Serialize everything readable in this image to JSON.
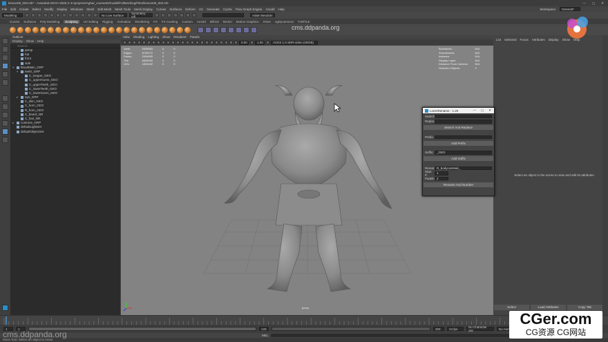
{
  "titlebar": {
    "title": "lesson09_003.mb* - Autodesk MAYA 2025.3: E:/projects/Agha/_course02/model/FullWorking/Files/lesson09_003.mb"
  },
  "menubar": {
    "items": [
      "File",
      "Edit",
      "Create",
      "Select",
      "Modify",
      "Display",
      "Windows",
      "Mesh",
      "Edit Mesh",
      "Mesh Tools",
      "Mesh Display",
      "Curves",
      "Surfaces",
      "Deform",
      "UV",
      "Generate",
      "Cache",
      "Flow Graph Engine",
      "Arnold",
      "Help"
    ],
    "workspace_label": "Workspace:",
    "workspace_value": "General*"
  },
  "statusline": {
    "mode": "Modeling",
    "live_surface": "No Live Surface",
    "symmetry": "Symmetry: Off",
    "user": "Adam Beudoin"
  },
  "shelf": {
    "tabs": [
      "Curves",
      "Surfaces",
      "Poly Modeling",
      "Sculpting",
      "UV Editing",
      "Rigging",
      "Animation",
      "Rendering",
      "FX",
      "FX Caching",
      "Custom",
      "Arnold",
      "Bifrost",
      "MASH",
      "Motion Graphics",
      "XGen",
      "xgDynamics2",
      "TURTLE"
    ],
    "active_tab": "Sculpting"
  },
  "outliner": {
    "title": "Outliner",
    "menu": [
      "Display",
      "Show",
      "Help"
    ],
    "search_placeholder": "Search...",
    "items": [
      {
        "label": "persp",
        "indent": 1,
        "arrow": ""
      },
      {
        "label": "top",
        "indent": 1,
        "arrow": ""
      },
      {
        "label": "front",
        "indent": 1,
        "arrow": ""
      },
      {
        "label": "side",
        "indent": 1,
        "arrow": ""
      },
      {
        "label": "bloodMain_GRP",
        "indent": 0,
        "arrow": "▾"
      },
      {
        "label": "teeth_GRP",
        "indent": 1,
        "arrow": "▾"
      },
      {
        "label": "C_tongue_GEO",
        "indent": 2,
        "arrow": ""
      },
      {
        "label": "C_upperGums_GEO",
        "indent": 2,
        "arrow": ""
      },
      {
        "label": "C_upperTeeth_GEO",
        "indent": 2,
        "arrow": ""
      },
      {
        "label": "C_lowerTeeth_GEO",
        "indent": 2,
        "arrow": ""
      },
      {
        "label": "C_lowerGums_GEO",
        "indent": 2,
        "arrow": ""
      },
      {
        "label": "eye_GRP",
        "indent": 1,
        "arrow": "▸"
      },
      {
        "label": "C_skin_GEO",
        "indent": 1,
        "arrow": ""
      },
      {
        "label": "C_horn_GEO",
        "indent": 1,
        "arrow": ""
      },
      {
        "label": "R_horn_GEO",
        "indent": 1,
        "arrow": ""
      },
      {
        "label": "C_beard_NR",
        "indent": 1,
        "arrow": ""
      },
      {
        "label": "C_hair_NR",
        "indent": 1,
        "arrow": ""
      },
      {
        "label": "costume_GRP",
        "indent": 0,
        "arrow": "▸"
      },
      {
        "label": "defaultLightSet",
        "indent": 0,
        "arrow": ""
      },
      {
        "label": "defaultObjectSet",
        "indent": 0,
        "arrow": ""
      }
    ]
  },
  "viewport": {
    "menu": [
      "View",
      "Shading",
      "Lighting",
      "Show",
      "Renderer",
      "Panels"
    ],
    "hud": [
      {
        "label": "Verts:",
        "a": "2935963",
        "b": "0",
        "c": "0"
      },
      {
        "label": "Edges:",
        "a": "8709272",
        "b": "0",
        "c": "0"
      },
      {
        "label": "Faces:",
        "a": "2934695",
        "b": "0",
        "c": "0"
      },
      {
        "label": "Tris:",
        "a": "4899090",
        "b": "0",
        "c": "0"
      },
      {
        "label": "UVs:",
        "a": "1834432",
        "b": "0",
        "c": "0"
      }
    ],
    "camera_label": "persp",
    "toolbar_field_a": "0.00",
    "toolbar_field_b": "1.00",
    "colorspace": "ACES 1.0 SDR-video (sRGB)"
  },
  "rightpanel": {
    "menu": [
      "List",
      "Selected",
      "Focus",
      "Attributes",
      "Display",
      "Show",
      "Help"
    ],
    "empty_message": "Select an object in the scene to view and edit its attributes",
    "info": [
      {
        "label": "Backfaces:",
        "value": "N/A"
      },
      {
        "label": "Smoothness:",
        "value": "N/A"
      },
      {
        "label": "Instance:",
        "value": "N/A"
      },
      {
        "label": "Display Layer:",
        "value": "N/A"
      },
      {
        "label": "Distance From Camera:",
        "value": "N/A"
      },
      {
        "label": "Selected Objects:",
        "value": "0"
      }
    ],
    "buttons": [
      "Select",
      "Load Attributes",
      "Copy Tab"
    ]
  },
  "dialog": {
    "title": "LorenRename - 1.20",
    "search_label": "Search:",
    "search_value": "",
    "replace_label": "Replace:",
    "replace_value": "",
    "search_button": "Search And Replace",
    "prefix_label": "Prefix:",
    "prefix_value": "",
    "prefix_button": "Add Prefix",
    "suffix_label": "Suffix:",
    "suffix_value": "_GEO",
    "suffix_button": "Add Suffix",
    "rename_label": "Rename:",
    "rename_value": "R_bodycostHair_",
    "start_label": "Start #:",
    "start_value": "1",
    "padding_label": "Padding:",
    "padding_value": "2",
    "rename_button": "Rename And Number"
  },
  "timeline": {
    "start": "1",
    "end": "120",
    "range_start": "1",
    "range_end": "120",
    "anim_end": "200",
    "current_frame": "1",
    "fps": "24 fps",
    "char_set": "No Character Set",
    "anim_layer": "No Anim Layer"
  },
  "cmdline": {
    "lang": "MEL"
  },
  "helpline": {
    "text": "Move Tool: Select an object to move"
  },
  "watermarks": {
    "top": "cms.ddpanda.org",
    "bottom": "cms.ddpanda.org",
    "brand": "CGer.com",
    "brand_sub": "CG资源 CG网站"
  }
}
